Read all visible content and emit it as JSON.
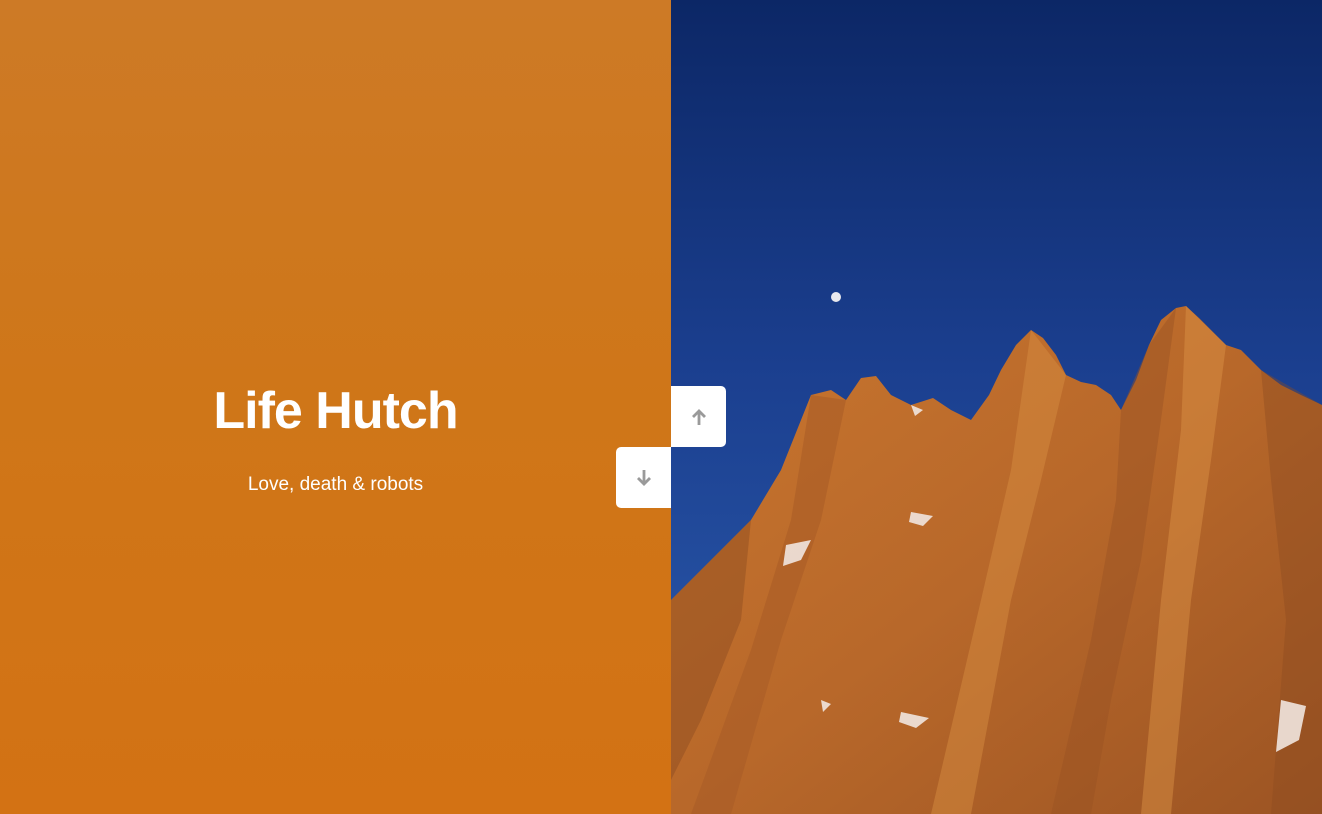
{
  "hero": {
    "title": "Life Hutch",
    "subtitle": "Love, death & robots"
  },
  "navigation": {
    "up_icon": "arrow-up-icon",
    "down_icon": "arrow-down-icon"
  },
  "colors": {
    "accent_orange": "#cf7618",
    "sky_top": "#0d2a6e",
    "sky_bottom": "#2a5bb0",
    "rock": "#c06a2a",
    "button_bg": "#ffffff",
    "icon_gray": "#9a9a9a"
  }
}
